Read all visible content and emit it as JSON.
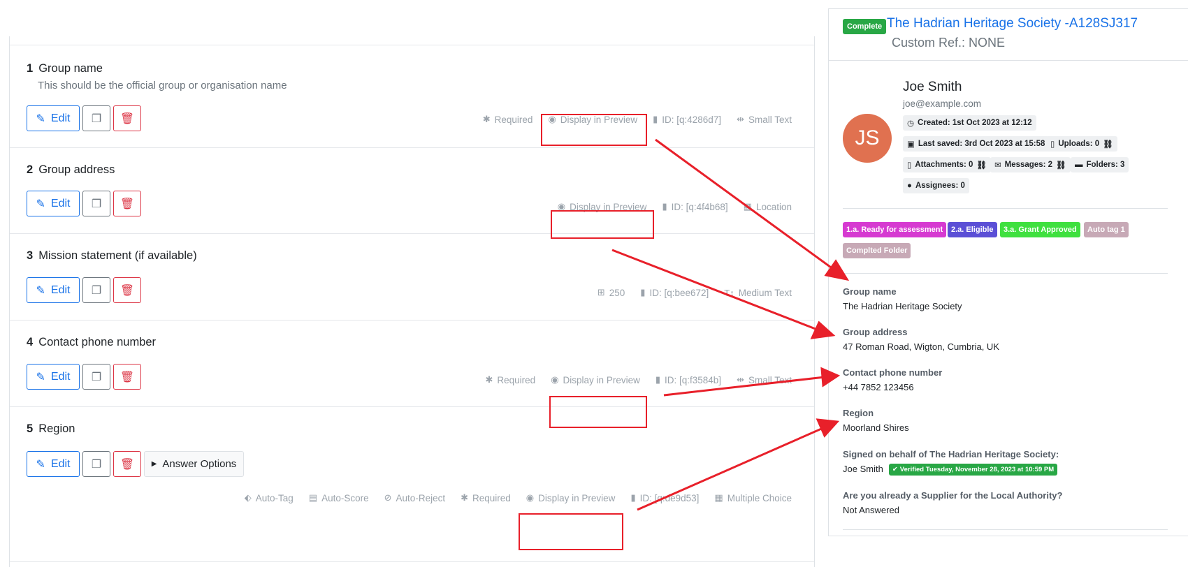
{
  "questions": [
    {
      "num": "1",
      "title": "Group name",
      "desc": "This should be the official group or organisation name",
      "meta": {
        "required": "Required",
        "preview": "Display in Preview",
        "id": "ID: [q:4286d7]",
        "type": "Small Text"
      }
    },
    {
      "num": "2",
      "title": "Group address",
      "meta": {
        "preview": "Display in Preview",
        "id": "ID: [q:4f4b68]",
        "type": "Location"
      }
    },
    {
      "num": "3",
      "title": "Mission statement (if available)",
      "meta": {
        "limit": "250",
        "id": "ID: [q:bee672]",
        "type": "Medium Text"
      }
    },
    {
      "num": "4",
      "title": "Contact phone number",
      "meta": {
        "required": "Required",
        "preview": "Display in Preview",
        "id": "ID: [q:f3584b]",
        "type": "Small Text"
      }
    },
    {
      "num": "5",
      "title": "Region",
      "answer_options": "Answer Options",
      "meta": {
        "autotag": "Auto-Tag",
        "autoscore": "Auto-Score",
        "autoreject": "Auto-Reject",
        "required": "Required",
        "preview": "Display in Preview",
        "id": "ID: [q:de9d53]",
        "type": "Multiple Choice"
      }
    }
  ],
  "edit_label": "Edit",
  "submission": {
    "status": "Complete",
    "title": "The Hadrian Heritage Society -A128SJ317",
    "custom_ref": "Custom Ref.: NONE",
    "user": {
      "initials": "JS",
      "name": "Joe Smith",
      "email": "joe@example.com"
    },
    "stats": {
      "created": "Created: 1st Oct 2023 at 12:12",
      "saved": "Last saved: 3rd Oct 2023 at 15:58",
      "uploads": "Uploads: 0",
      "attachments": "Attachments: 0",
      "messages": "Messages: 2",
      "folders": "Folders: 3",
      "assignees": "Assignees: 0"
    },
    "tags": [
      {
        "label": "1.a. Ready for assessment",
        "color": "#d63ad1"
      },
      {
        "label": "2.a. Eligible",
        "color": "#5b4fd6"
      },
      {
        "label": "3.a. Grant Approved",
        "color": "#3fe03f"
      },
      {
        "label": "Auto tag 1",
        "color": "#c7a9b6"
      },
      {
        "label": "Complted Folder",
        "color": "#c7a9b6"
      }
    ],
    "fields": [
      {
        "label": "Group name",
        "value": "The Hadrian Heritage Society"
      },
      {
        "label": "Group address",
        "value": "47 Roman Road, Wigton, Cumbria, UK"
      },
      {
        "label": "Contact phone number",
        "value": "+44 7852 123456"
      },
      {
        "label": "Region",
        "value": "Moorland Shires"
      },
      {
        "label": "Signed on behalf of The Hadrian Heritage Society:",
        "value": "Joe Smith",
        "verified": "Verified Tuesday, November 28, 2023 at 10:59 PM"
      },
      {
        "label": "Are you already a Supplier for the Local Authority?",
        "value": "Not Answered"
      }
    ]
  },
  "colors": {
    "accent": "#1a73e8",
    "danger": "#dc3545",
    "success": "#28a745",
    "annotation": "#e8202a"
  }
}
